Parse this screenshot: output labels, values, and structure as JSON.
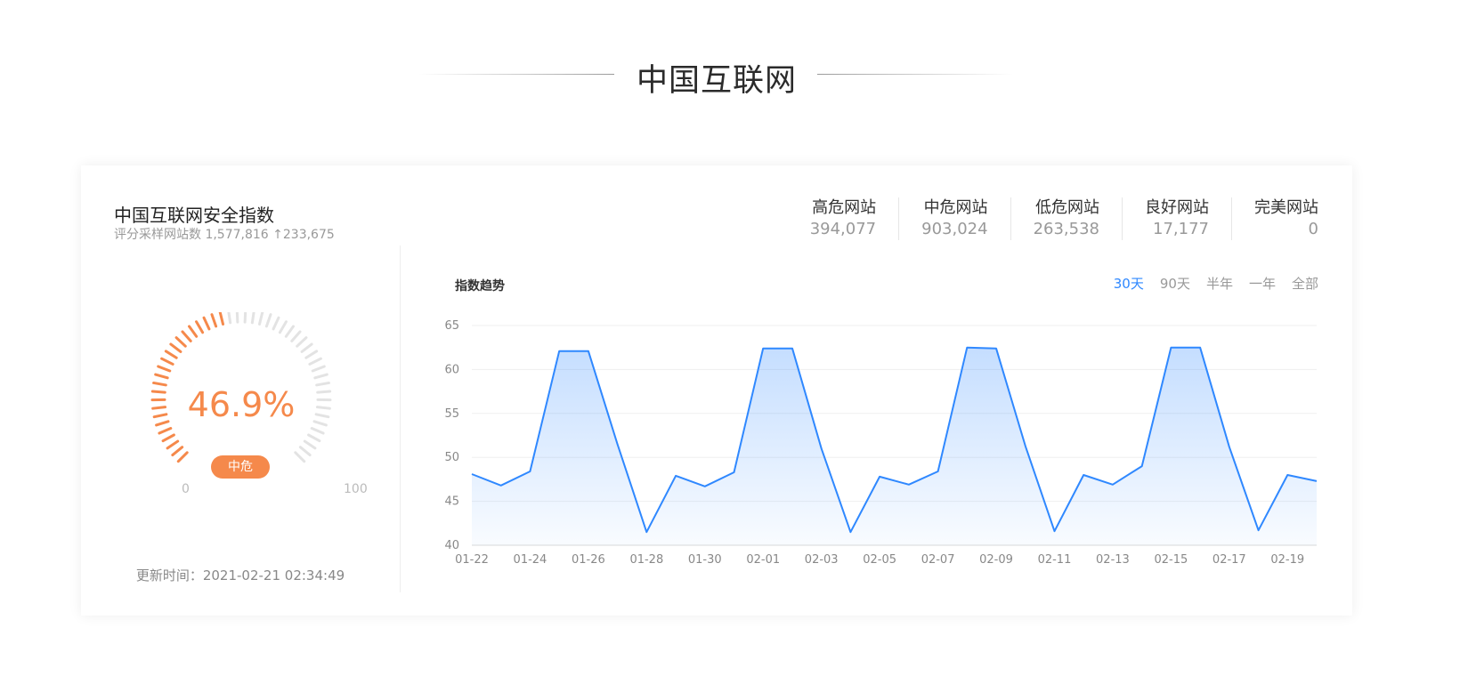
{
  "page": {
    "title": "中国互联网"
  },
  "card": {
    "title": "中国互联网安全指数",
    "subtitle": "评分采样网站数 1,577,816 ↑233,675",
    "stats": [
      {
        "label": "高危网站",
        "value": "394,077"
      },
      {
        "label": "中危网站",
        "value": "903,024"
      },
      {
        "label": "低危网站",
        "value": "263,538"
      },
      {
        "label": "良好网站",
        "value": "17,177"
      },
      {
        "label": "完美网站",
        "value": "0"
      }
    ]
  },
  "gauge": {
    "value_text": "46.9%",
    "percent": 46.9,
    "level": "中危",
    "min": "0",
    "max": "100",
    "active_color": "#f5894b",
    "inactive_color": "#e3e3e3"
  },
  "update": {
    "text": "更新时间：2021-02-21 02:34:49"
  },
  "trend": {
    "title": "指数趋势",
    "ranges": [
      "30天",
      "90天",
      "半年",
      "一年",
      "全部"
    ],
    "active_range": "30天"
  },
  "chart_data": {
    "type": "area",
    "xlabel": "",
    "ylabel": "",
    "ylim": [
      40,
      65
    ],
    "yticks": [
      40,
      45,
      50,
      55,
      60,
      65
    ],
    "grid": true,
    "line_color": "#2f88ff",
    "x": [
      "01-22",
      "01-23",
      "01-24",
      "01-25",
      "01-26",
      "01-27",
      "01-28",
      "01-29",
      "01-30",
      "01-31",
      "02-01",
      "02-02",
      "02-03",
      "02-04",
      "02-05",
      "02-06",
      "02-07",
      "02-08",
      "02-09",
      "02-10",
      "02-11",
      "02-12",
      "02-13",
      "02-14",
      "02-15",
      "02-16",
      "02-17",
      "02-18",
      "02-19",
      "02-20"
    ],
    "xtick_labels": [
      "01-22",
      "01-24",
      "01-26",
      "01-28",
      "01-30",
      "02-01",
      "02-03",
      "02-05",
      "02-07",
      "02-09",
      "02-11",
      "02-13",
      "02-15",
      "02-17",
      "02-19"
    ],
    "series": [
      {
        "values": [
          48.1,
          46.8,
          48.4,
          62.1,
          62.1,
          51.5,
          41.5,
          47.9,
          46.7,
          48.3,
          62.4,
          62.4,
          51.0,
          41.5,
          47.8,
          46.9,
          48.4,
          62.5,
          62.4,
          51.3,
          41.6,
          48.0,
          46.9,
          49.0,
          62.5,
          62.5,
          51.2,
          41.7,
          48.0,
          47.3
        ]
      }
    ]
  }
}
